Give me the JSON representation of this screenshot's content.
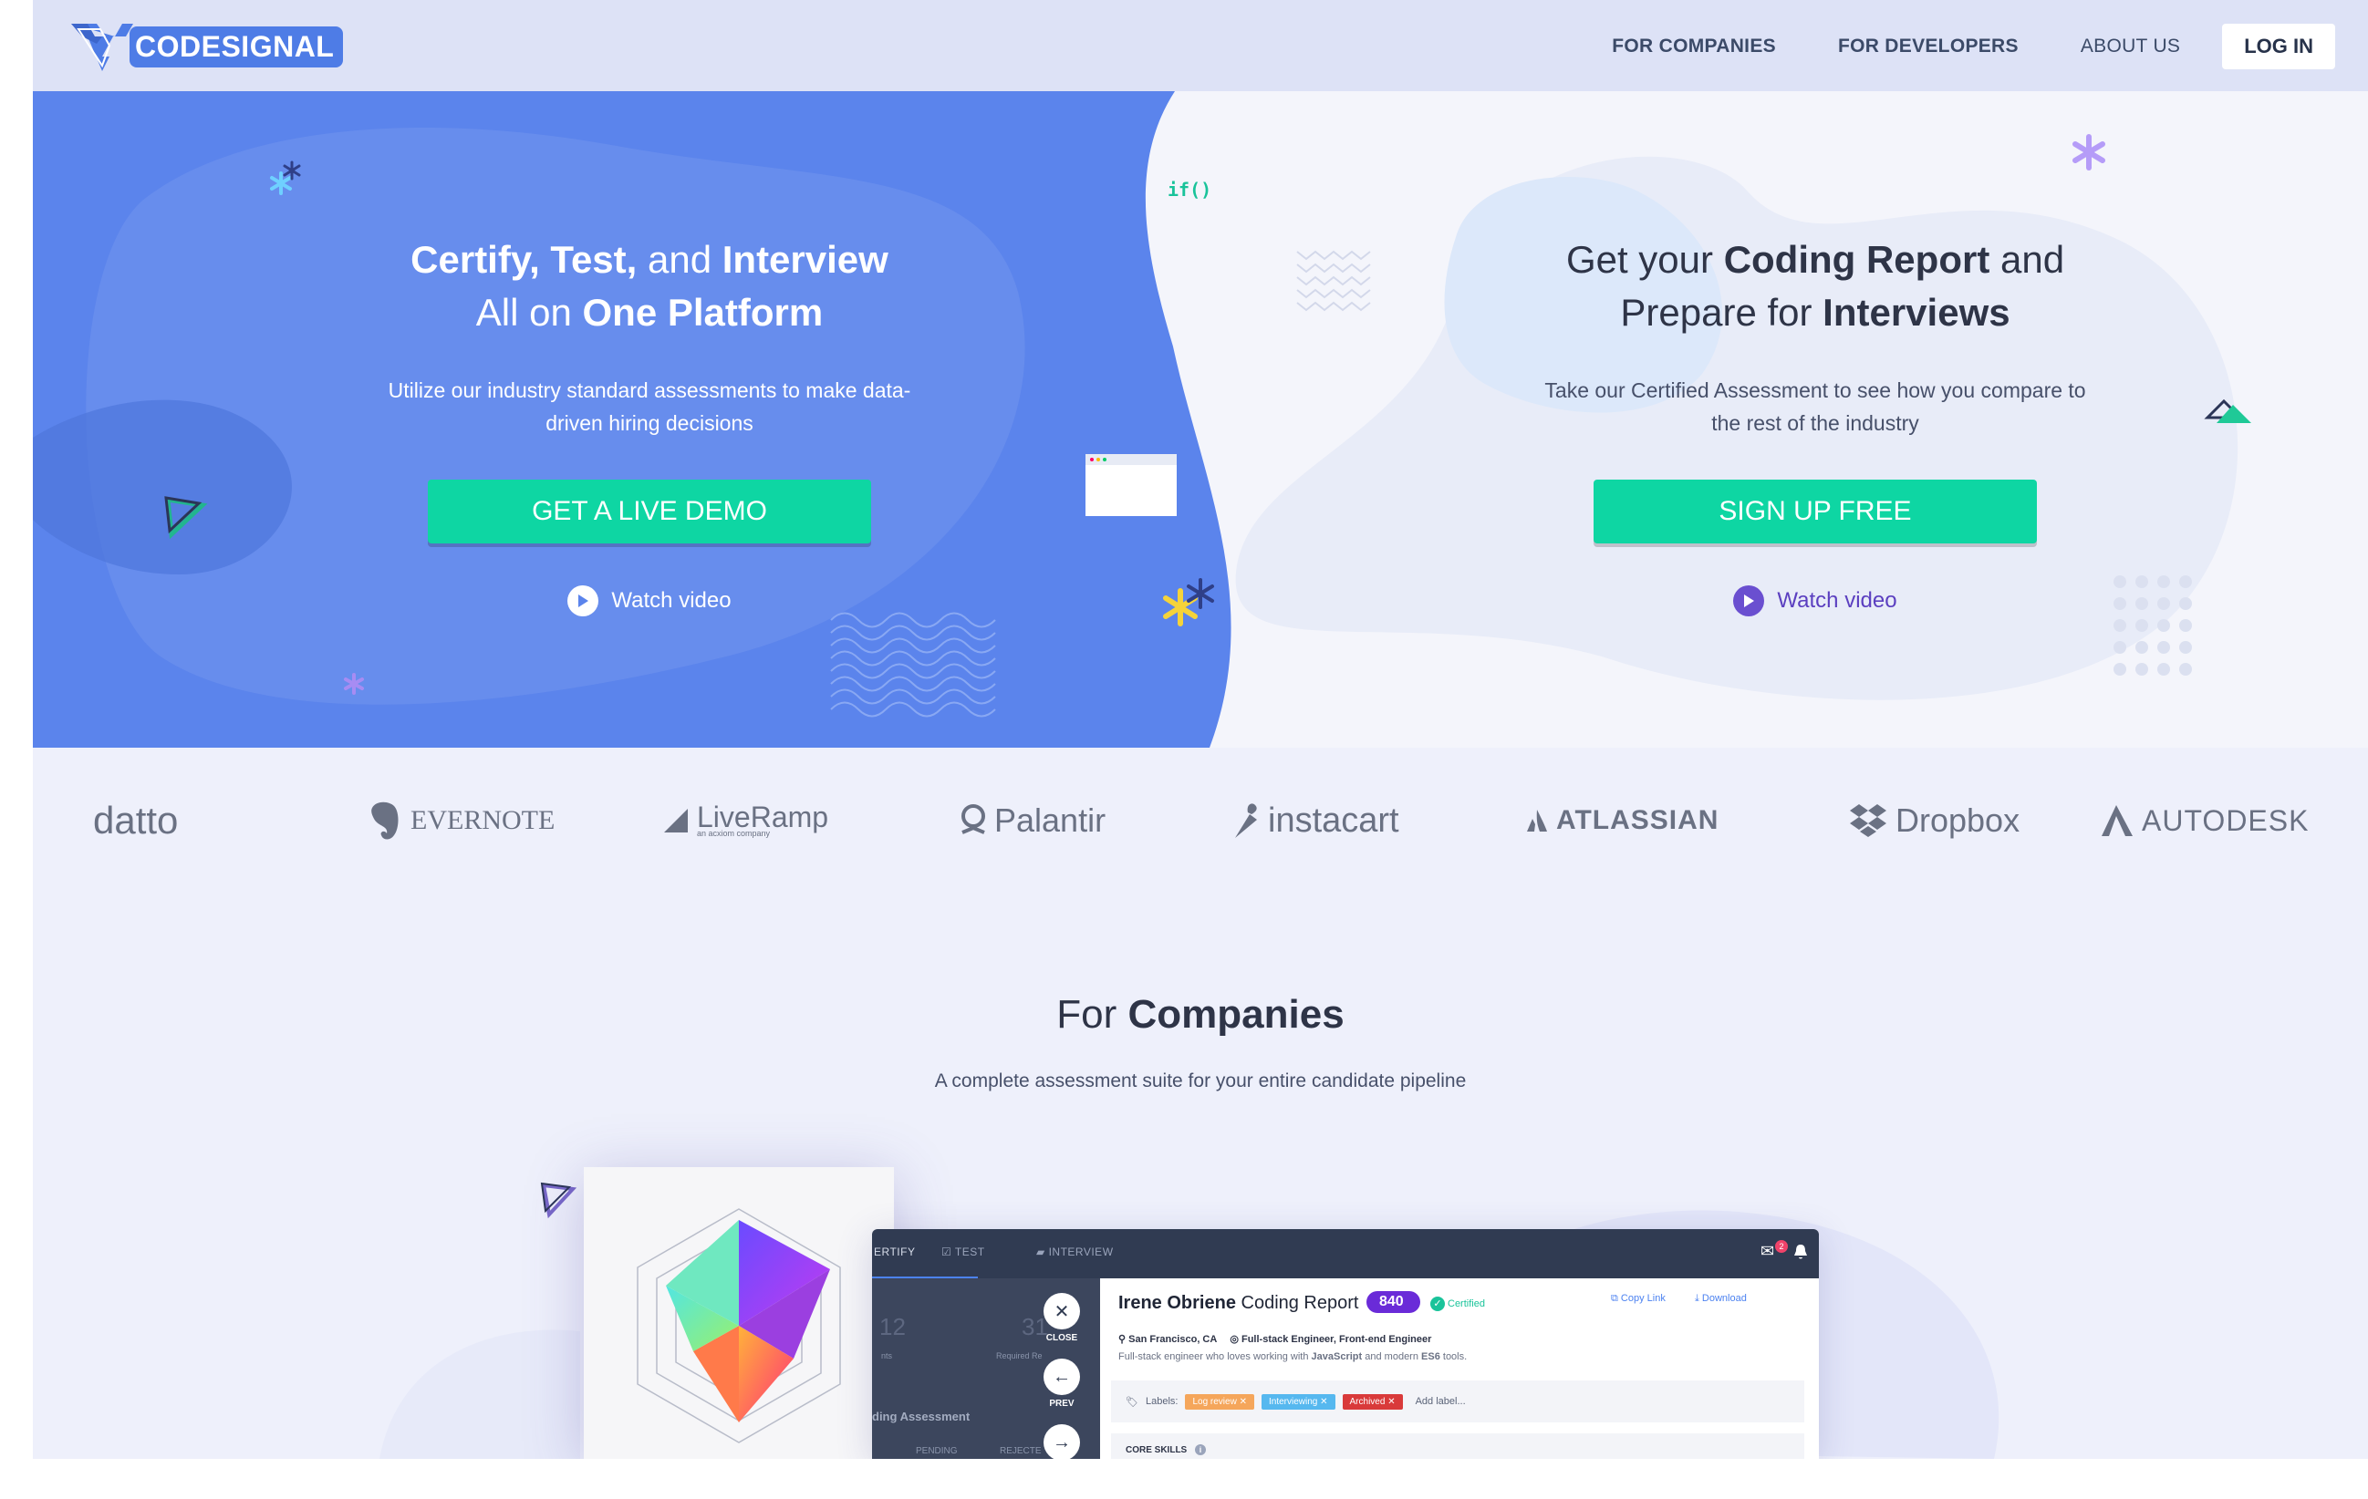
{
  "brand": {
    "name": "CODESIGNAL"
  },
  "nav": {
    "links": [
      "FOR COMPANIES",
      "FOR DEVELOPERS",
      "ABOUT US"
    ],
    "login": "LOG IN"
  },
  "hero": {
    "code_snippet": "if()",
    "left": {
      "title_line1_a": "Certify, Test,",
      "title_line1_b": " and ",
      "title_line1_c": "Interview",
      "title_line2_a": "All on ",
      "title_line2_b": "One Platform",
      "subtitle": "Utilize our industry standard assessments to make data-driven hiring decisions",
      "cta": "GET A LIVE DEMO",
      "watch": "Watch video"
    },
    "right": {
      "title_line1_a": "Get your ",
      "title_line1_b": "Coding Report",
      "title_line1_c": " and",
      "title_line2_a": "Prepare for ",
      "title_line2_b": "Interviews",
      "subtitle": "Take our Certified Assessment to see how you compare to the rest of the industry",
      "cta": "SIGN UP FREE",
      "watch": "Watch video"
    },
    "colors": {
      "blue": "#5b84ec",
      "teal": "#0ed6a3",
      "purple": "#6a4fd0"
    }
  },
  "logos": [
    "datto",
    "EVERNOTE",
    "LiveRamp",
    "an acxiom company",
    "Palantir",
    "instacart",
    "ATLASSIAN",
    "Dropbox",
    "AUTODESK"
  ],
  "companies": {
    "title_a": "For ",
    "title_b": "Companies",
    "subtitle": "A complete assessment suite for your entire candidate pipeline"
  },
  "app": {
    "tabs": [
      "ERTIFY",
      "TEST",
      "INTERVIEW"
    ],
    "left": {
      "num1": "12",
      "num2": "31",
      "small1": "nts",
      "small2": "Required Re",
      "assessment": "ding Assessment",
      "pending": "PENDING",
      "rejected": "REJECTE"
    },
    "side_buttons": [
      "CLOSE",
      "PREV"
    ],
    "report": {
      "name": "Irene Obriene",
      "label": "Coding Report",
      "score": "840",
      "certified": "Certified",
      "copy_link": "Copy Link",
      "download": "Download",
      "location": "San Francisco, CA",
      "role": "Full-stack Engineer, Front-end Engineer",
      "desc_a": "Full-stack engineer who loves working with ",
      "desc_b": "JavaScript",
      "desc_c": " and modern ",
      "desc_d": "ES6",
      "desc_e": " tools.",
      "labels_title": "Labels:",
      "tags": [
        "Log review",
        "Interviewing",
        "Archived"
      ],
      "add_label": "Add label...",
      "core_skills": "CORE SKILLS"
    },
    "notification_count": "2"
  }
}
